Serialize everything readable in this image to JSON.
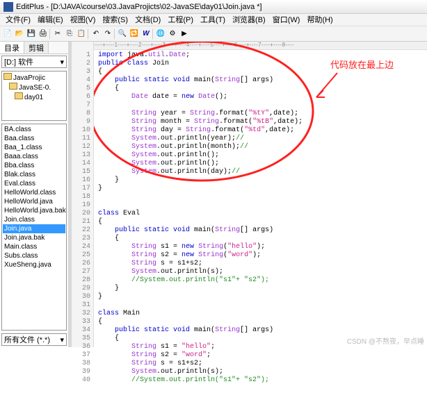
{
  "title": "EditPlus - [D:\\JAVA\\course\\03.JavaProjicts\\02-JavaSE\\day01\\Join.java *]",
  "menu": [
    "文件(F)",
    "编辑(E)",
    "视图(V)",
    "搜索(S)",
    "文档(D)",
    "工程(P)",
    "工具(T)",
    "浏览器(B)",
    "窗口(W)",
    "帮助(H)"
  ],
  "sidebar": {
    "tab_dir": "目录",
    "tab_clip": "剪辑",
    "drive": "[D:] 软件",
    "tree": [
      "JavaProjic",
      "JavaSE-0.",
      "day01"
    ],
    "files": [
      "BA.class",
      "Baa.class",
      "Baa_1.class",
      "Baaa.class",
      "Bba.class",
      "Blak.class",
      "Eval.class",
      "HelloWorld.class",
      "HelloWorld.java",
      "HelloWorld.java.bak",
      "Join.class",
      "Join.java",
      "Join.java.bak",
      "Main.class",
      "Subs.class",
      "XueSheng.java"
    ],
    "selected_file": "Join.java",
    "filter": "所有文件 (*.*)"
  },
  "ruler": "----+----1----+----2----+----3----+----4----+----5----+----6----+----7----+----8----",
  "annotation": "代码放在最上边",
  "code_lines": [
    {
      "n": 1,
      "seg": [
        {
          "c": "kw",
          "t": "import"
        },
        {
          "t": " java."
        },
        {
          "c": "id",
          "t": "util"
        },
        {
          "t": "."
        },
        {
          "c": "id",
          "t": "Date"
        },
        {
          "t": ";"
        }
      ]
    },
    {
      "n": 2,
      "seg": [
        {
          "c": "kw",
          "t": "public class"
        },
        {
          "t": " Join"
        }
      ]
    },
    {
      "n": 3,
      "seg": [
        {
          "t": "{"
        }
      ]
    },
    {
      "n": 4,
      "seg": [
        {
          "t": "    "
        },
        {
          "c": "kw",
          "t": "public static void"
        },
        {
          "t": " main("
        },
        {
          "c": "id",
          "t": "String"
        },
        {
          "t": "[] args)"
        }
      ]
    },
    {
      "n": 5,
      "seg": [
        {
          "t": "    {"
        }
      ]
    },
    {
      "n": 6,
      "seg": [
        {
          "t": "        "
        },
        {
          "c": "id",
          "t": "Date"
        },
        {
          "t": " date = "
        },
        {
          "c": "kw",
          "t": "new"
        },
        {
          "t": " "
        },
        {
          "c": "id",
          "t": "Date"
        },
        {
          "t": "();"
        }
      ]
    },
    {
      "n": 7,
      "seg": [
        {
          "t": ""
        }
      ]
    },
    {
      "n": 8,
      "seg": [
        {
          "t": "        "
        },
        {
          "c": "id",
          "t": "String"
        },
        {
          "t": " year = "
        },
        {
          "c": "id",
          "t": "String"
        },
        {
          "t": ".format("
        },
        {
          "c": "str",
          "t": "\"%tY\""
        },
        {
          "t": ",date);"
        }
      ]
    },
    {
      "n": 9,
      "seg": [
        {
          "t": "        "
        },
        {
          "c": "id",
          "t": "String"
        },
        {
          "t": " month = "
        },
        {
          "c": "id",
          "t": "String"
        },
        {
          "t": ".format("
        },
        {
          "c": "str",
          "t": "\"%tB\""
        },
        {
          "t": ",date);"
        }
      ]
    },
    {
      "n": 10,
      "seg": [
        {
          "t": "        "
        },
        {
          "c": "id",
          "t": "String"
        },
        {
          "t": " day = "
        },
        {
          "c": "id",
          "t": "String"
        },
        {
          "t": ".format("
        },
        {
          "c": "str",
          "t": "\"%td\""
        },
        {
          "t": ",date);"
        }
      ]
    },
    {
      "n": 11,
      "seg": [
        {
          "t": "        "
        },
        {
          "c": "id",
          "t": "System"
        },
        {
          "t": ".out.println(year);"
        },
        {
          "c": "cmt",
          "t": "//"
        }
      ]
    },
    {
      "n": 12,
      "seg": [
        {
          "t": "        "
        },
        {
          "c": "id",
          "t": "System"
        },
        {
          "t": ".out.println(month);"
        },
        {
          "c": "cmt",
          "t": "//"
        }
      ]
    },
    {
      "n": 13,
      "seg": [
        {
          "t": "        "
        },
        {
          "c": "id",
          "t": "System"
        },
        {
          "t": ".out.println();"
        }
      ]
    },
    {
      "n": 14,
      "seg": [
        {
          "t": "        "
        },
        {
          "c": "id",
          "t": "System"
        },
        {
          "t": ".out.println();"
        }
      ]
    },
    {
      "n": 15,
      "seg": [
        {
          "t": "        "
        },
        {
          "c": "id",
          "t": "System"
        },
        {
          "t": ".out.println(day);"
        },
        {
          "c": "cmt",
          "t": "//"
        }
      ]
    },
    {
      "n": 16,
      "seg": [
        {
          "t": "    }"
        }
      ]
    },
    {
      "n": 17,
      "seg": [
        {
          "t": "}"
        }
      ]
    },
    {
      "n": 18,
      "seg": [
        {
          "t": ""
        }
      ]
    },
    {
      "n": 19,
      "seg": [
        {
          "t": ""
        }
      ]
    },
    {
      "n": 20,
      "seg": [
        {
          "c": "kw",
          "t": "class"
        },
        {
          "t": " Eval"
        }
      ]
    },
    {
      "n": 21,
      "seg": [
        {
          "t": "{"
        }
      ]
    },
    {
      "n": 22,
      "seg": [
        {
          "t": "    "
        },
        {
          "c": "kw",
          "t": "public static void"
        },
        {
          "t": " main("
        },
        {
          "c": "id",
          "t": "String"
        },
        {
          "t": "[] args)"
        }
      ]
    },
    {
      "n": 23,
      "seg": [
        {
          "t": "    {"
        }
      ]
    },
    {
      "n": 24,
      "seg": [
        {
          "t": "        "
        },
        {
          "c": "id",
          "t": "String"
        },
        {
          "t": " s1 = "
        },
        {
          "c": "kw",
          "t": "new"
        },
        {
          "t": " "
        },
        {
          "c": "id",
          "t": "String"
        },
        {
          "t": "("
        },
        {
          "c": "str",
          "t": "\"hello\""
        },
        {
          "t": ");"
        }
      ]
    },
    {
      "n": 25,
      "seg": [
        {
          "t": "        "
        },
        {
          "c": "id",
          "t": "String"
        },
        {
          "t": " s2 = "
        },
        {
          "c": "kw",
          "t": "new"
        },
        {
          "t": " "
        },
        {
          "c": "id",
          "t": "String"
        },
        {
          "t": "("
        },
        {
          "c": "str",
          "t": "\"word\""
        },
        {
          "t": ");"
        }
      ]
    },
    {
      "n": 26,
      "seg": [
        {
          "t": "        "
        },
        {
          "c": "id",
          "t": "String"
        },
        {
          "t": " s = s1+s2;"
        }
      ]
    },
    {
      "n": 27,
      "seg": [
        {
          "t": "        "
        },
        {
          "c": "id",
          "t": "System"
        },
        {
          "t": ".out.println(s);"
        }
      ]
    },
    {
      "n": 28,
      "seg": [
        {
          "t": "        "
        },
        {
          "c": "cmt",
          "t": "//System.out.println(\"s1\"+ \"s2\");"
        }
      ]
    },
    {
      "n": 29,
      "seg": [
        {
          "t": "    }"
        }
      ]
    },
    {
      "n": 30,
      "seg": [
        {
          "t": "}"
        }
      ]
    },
    {
      "n": 31,
      "seg": [
        {
          "t": ""
        }
      ]
    },
    {
      "n": 32,
      "seg": [
        {
          "c": "kw",
          "t": "class"
        },
        {
          "t": " Main"
        }
      ]
    },
    {
      "n": 33,
      "seg": [
        {
          "t": "{"
        }
      ]
    },
    {
      "n": 34,
      "seg": [
        {
          "t": "    "
        },
        {
          "c": "kw",
          "t": "public static void"
        },
        {
          "t": " main("
        },
        {
          "c": "id",
          "t": "String"
        },
        {
          "t": "[] args)"
        }
      ]
    },
    {
      "n": 35,
      "seg": [
        {
          "t": "    {"
        }
      ]
    },
    {
      "n": 36,
      "seg": [
        {
          "t": "        "
        },
        {
          "c": "id",
          "t": "String"
        },
        {
          "t": " s1 = "
        },
        {
          "c": "str",
          "t": "\"hello\""
        },
        {
          "t": ";"
        }
      ]
    },
    {
      "n": 37,
      "seg": [
        {
          "t": "        "
        },
        {
          "c": "id",
          "t": "String"
        },
        {
          "t": " s2 = "
        },
        {
          "c": "str",
          "t": "\"word\""
        },
        {
          "t": ";"
        }
      ]
    },
    {
      "n": 38,
      "seg": [
        {
          "t": "        "
        },
        {
          "c": "id",
          "t": "String"
        },
        {
          "t": " s = s1+s2;"
        }
      ]
    },
    {
      "n": 39,
      "seg": [
        {
          "t": "        "
        },
        {
          "c": "id",
          "t": "System"
        },
        {
          "t": ".out.println(s);"
        }
      ]
    },
    {
      "n": 40,
      "seg": [
        {
          "t": "        "
        },
        {
          "c": "cmt",
          "t": "//System.out.println(\"s1\"+ \"s2\");"
        }
      ]
    }
  ],
  "watermark": "CSDN @不熬夜，早点睡"
}
